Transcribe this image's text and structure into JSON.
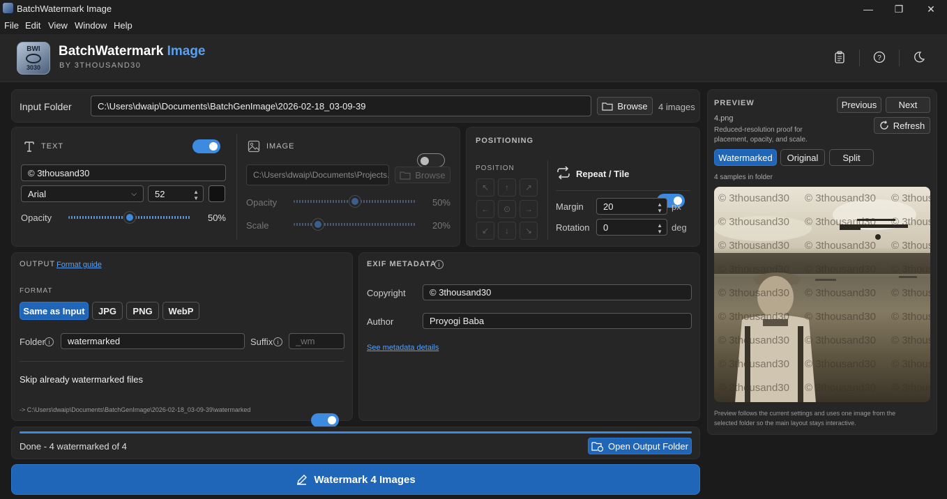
{
  "window": {
    "title": "BatchWatermark Image"
  },
  "menu": [
    "File",
    "Edit",
    "View",
    "Window",
    "Help"
  ],
  "app": {
    "title_main": "BatchWatermark",
    "title_accent": "Image",
    "subtitle": "BY 3THOUSAND30",
    "logo_top": "BWI",
    "logo_bottom": "3030"
  },
  "input": {
    "label": "Input Folder",
    "path": "C:\\Users\\dwaip\\Documents\\BatchGenImage\\2026-02-18_03-09-39",
    "browse": "Browse",
    "count": "4 images"
  },
  "text_panel": {
    "heading": "TEXT",
    "enabled": true,
    "text": "© 3thousand30",
    "font": "Arial",
    "size": "52",
    "opacity_label": "Opacity",
    "opacity_value": "50%",
    "opacity": 0.5
  },
  "image_panel": {
    "heading": "IMAGE",
    "enabled": false,
    "path": "C:\\Users\\dwaip\\Documents\\Projects...",
    "browse": "Browse",
    "opacity_label": "Opacity",
    "opacity_value": "50%",
    "opacity": 0.5,
    "scale_label": "Scale",
    "scale_value": "20%",
    "scale": 0.2
  },
  "positioning": {
    "heading": "POSITIONING",
    "position_label": "POSITION",
    "repeat_label": "Repeat / Tile",
    "repeat": true,
    "margin_label": "Margin",
    "margin": "20",
    "margin_unit": "px",
    "rotation_label": "Rotation",
    "rotation": "0",
    "rotation_unit": "deg"
  },
  "output": {
    "heading": "OUTPUT",
    "format_guide": "Format guide",
    "format_label": "FORMAT",
    "formats": [
      "Same as Input",
      "JPG",
      "PNG",
      "WebP"
    ],
    "folder_label": "Folder",
    "folder": "watermarked",
    "suffix_label": "Suffix",
    "suffix_placeholder": "_wm",
    "skip_label": "Skip already watermarked files",
    "skip": true,
    "output_path": "-> C:\\Users\\dwaip\\Documents\\BatchGenImage\\2026-02-18_03-09-39\\watermarked"
  },
  "exif": {
    "heading": "EXIF METADATA",
    "copyright_label": "Copyright",
    "copyright": "© 3thousand30",
    "author_label": "Author",
    "author": "Proyogi Baba",
    "details_link": "See metadata details"
  },
  "status": {
    "text": "Done - 4 watermarked of 4",
    "progress": 1.0,
    "open_output": "Open Output Folder"
  },
  "main_action": {
    "label": "Watermark 4 Images"
  },
  "preview": {
    "heading": "PREVIEW",
    "filename": "4.png",
    "desc1": "Reduced-resolution proof for",
    "desc2": "placement, opacity, and scale.",
    "previous": "Previous",
    "next": "Next",
    "refresh": "Refresh",
    "tabs": [
      "Watermarked",
      "Original",
      "Split"
    ],
    "samples": "4 samples in folder",
    "watermark_text": "© 3thousand30",
    "footnote1": "Preview follows the current settings and uses one image from the",
    "footnote2": "selected folder so the main layout stays interactive."
  },
  "colors": {
    "accent": "#3d8be0",
    "primary_button": "#1f66b8",
    "panel": "#262626",
    "background": "#1b1b1b"
  }
}
